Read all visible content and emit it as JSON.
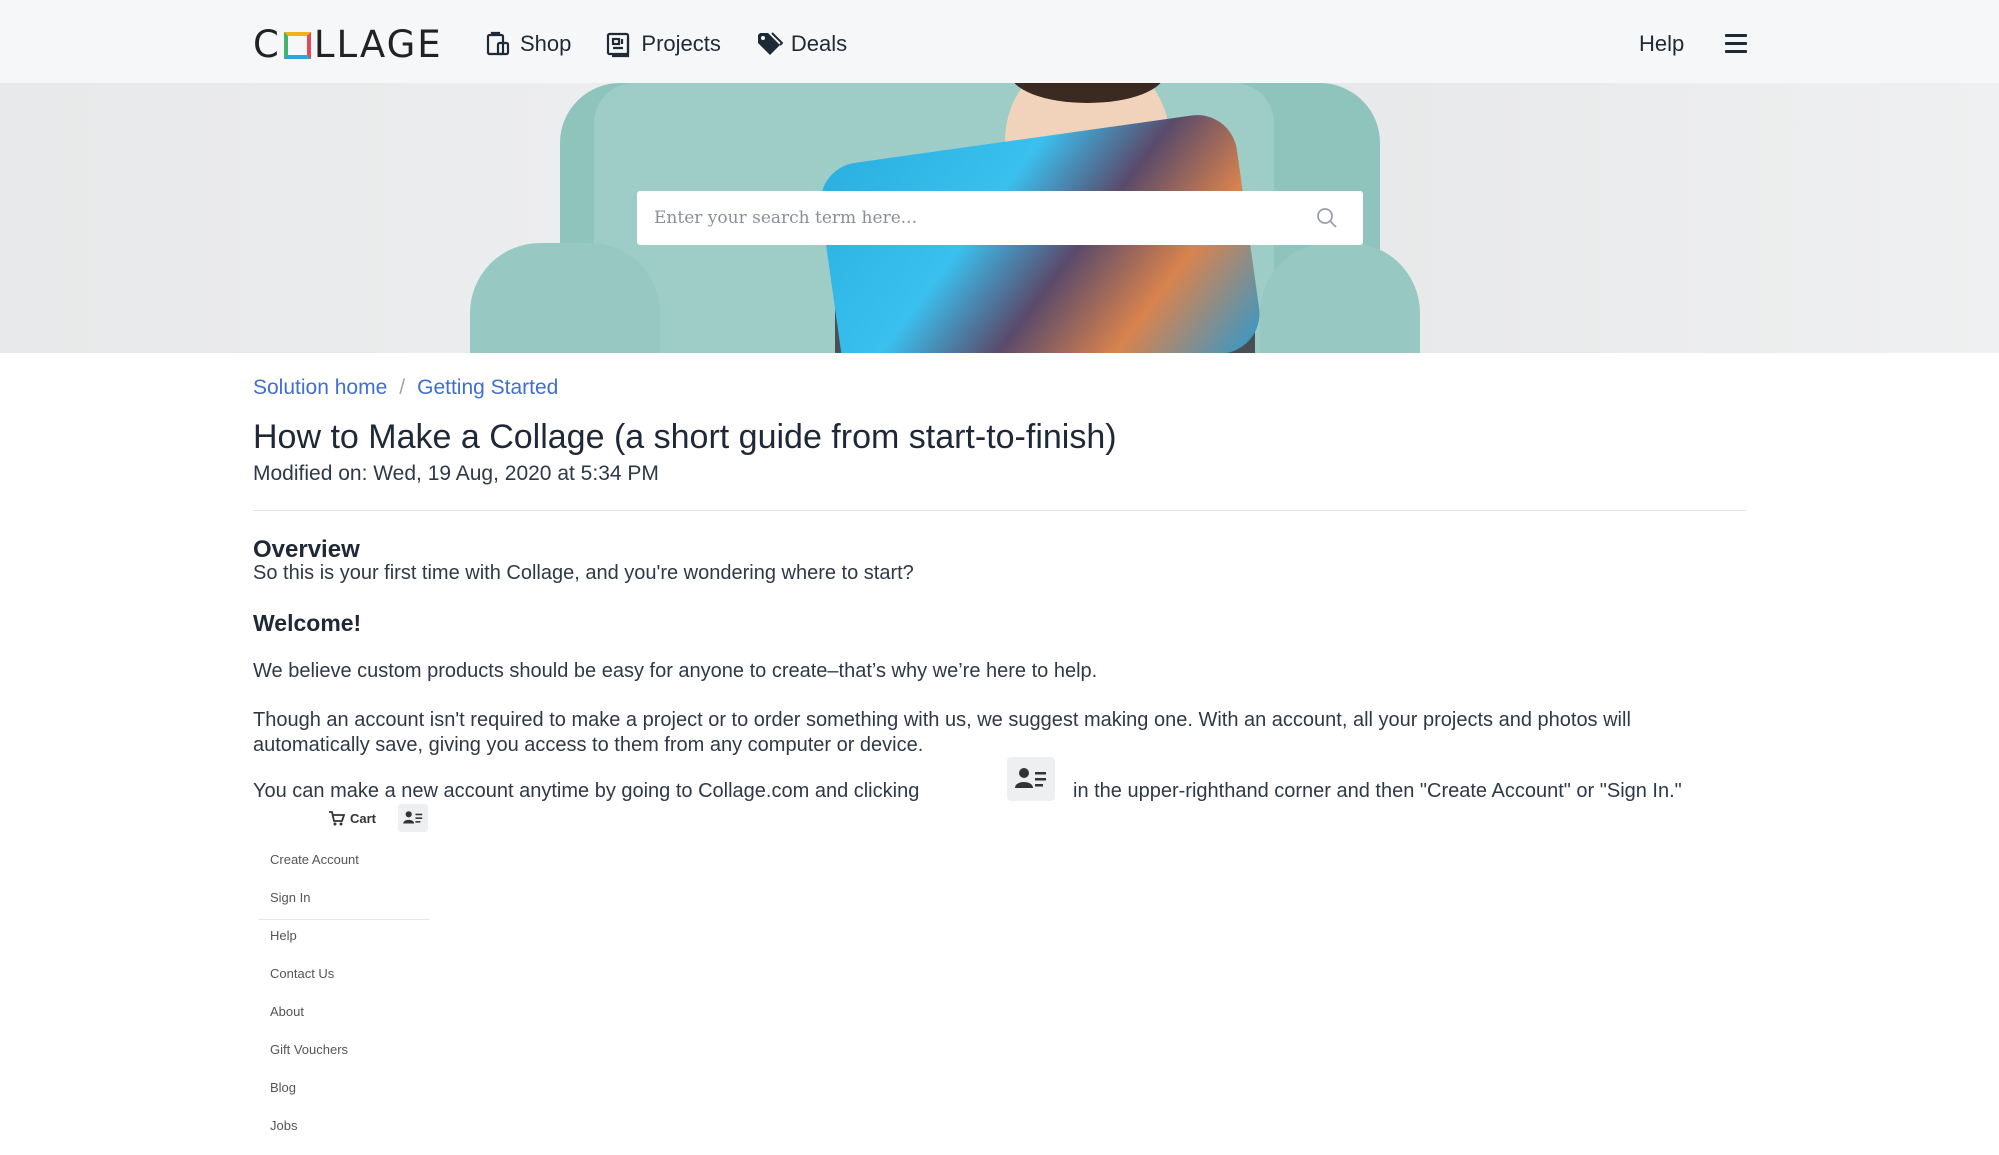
{
  "header": {
    "logo_text_1": "C",
    "logo_text_2": "LLAGE",
    "nav": [
      {
        "label": "Shop",
        "icon": "shop-bag-icon"
      },
      {
        "label": "Projects",
        "icon": "projects-icon"
      },
      {
        "label": "Deals",
        "icon": "tag-icon"
      }
    ],
    "help_label": "Help",
    "menu_icon": "hamburger-menu-icon"
  },
  "search": {
    "placeholder": "Enter your search term here...",
    "icon": "search-icon"
  },
  "breadcrumb": {
    "items": [
      "Solution home",
      "Getting Started"
    ],
    "separator": "/"
  },
  "article": {
    "title": "How to Make a Collage (a short guide from start-to-finish)",
    "modified": "Modified on: Wed, 19 Aug, 2020 at 5:34 PM",
    "overview_heading": "Overview",
    "overview_text": "So this is your first time with Collage, and you're wondering where to start?",
    "welcome_heading": "Welcome!",
    "para_custom": "We believe custom products should be easy for anyone to create–that’s why we’re here to help.",
    "para_account": "Though an account isn't required to make a project or to order something with us, we suggest making one. With an account, all your projects and photos will automatically save, giving you access to them from any computer or device.",
    "para_signup_before": "You can make a new account anytime by going to Collage.com and clicking",
    "para_signup_after": "in the upper-righthand corner and then \"Create Account\" or \"Sign In.\""
  },
  "dropdown_image": {
    "cart_label": "Cart",
    "items": [
      "Create Account",
      "Sign In",
      "Help",
      "Contact Us",
      "About",
      "Gift Vouchers",
      "Blog",
      "Jobs"
    ]
  },
  "colors": {
    "link": "#3f6fd2",
    "text": "#2a3441",
    "header_bg": "#f6f7f9"
  }
}
